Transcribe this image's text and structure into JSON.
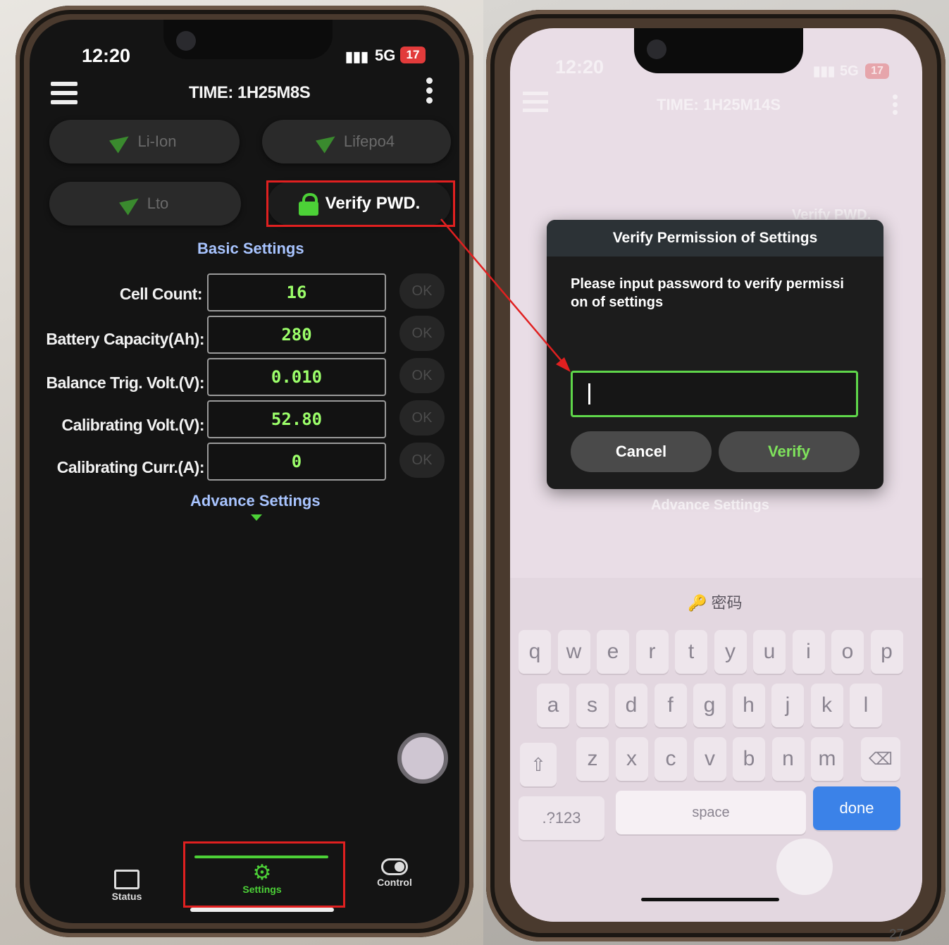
{
  "left_phone": {
    "status": {
      "time": "12:20",
      "signal": "5G",
      "battery": "17"
    },
    "header": {
      "title": "TIME: 1H25M8S"
    },
    "chemistry": [
      {
        "label": "Li-Ion"
      },
      {
        "label": "Lifepo4"
      },
      {
        "label": "Lto"
      }
    ],
    "verify_button": "Verify PWD.",
    "basic_settings_title": "Basic Settings",
    "settings": [
      {
        "label": "Cell Count:",
        "value": "16",
        "ok": "OK"
      },
      {
        "label": "Battery Capacity(Ah):",
        "value": "280",
        "ok": "OK"
      },
      {
        "label": "Balance Trig. Volt.(V):",
        "value": "0.010",
        "ok": "OK"
      },
      {
        "label": "Calibrating Volt.(V):",
        "value": "52.80",
        "ok": "OK"
      },
      {
        "label": "Calibrating Curr.(A):",
        "value": "0",
        "ok": "OK"
      }
    ],
    "advance_settings": "Advance Settings",
    "tabs": [
      {
        "label": "Status"
      },
      {
        "label": "Settings"
      },
      {
        "label": "Control"
      }
    ]
  },
  "right_phone": {
    "status": {
      "time": "12:20",
      "signal": "5G",
      "battery": "17"
    },
    "header": {
      "title": "TIME: 1H25M14S"
    },
    "bg_verify": "Verify PWD.",
    "bg_advance": "Advance Settings",
    "dialog": {
      "title": "Verify Permission of Settings",
      "message_line1": "Please input password to verify permissi",
      "message_line2": "on of settings",
      "input_value": "",
      "cancel": "Cancel",
      "verify": "Verify"
    },
    "keyboard": {
      "hint": "密码",
      "row1": [
        "q",
        "w",
        "e",
        "r",
        "t",
        "y",
        "u",
        "i",
        "o",
        "p"
      ],
      "row2": [
        "a",
        "s",
        "d",
        "f",
        "g",
        "h",
        "j",
        "k",
        "l"
      ],
      "row3": [
        "z",
        "x",
        "c",
        "v",
        "b",
        "n",
        "m"
      ],
      "numbers": ".?123",
      "space": "space",
      "done": "done"
    }
  },
  "page_number": "27",
  "colors": {
    "accent_green": "#9cff6a",
    "highlight_red": "#e02020",
    "done_blue": "#3b82e8",
    "lock_green": "#4cd137"
  }
}
